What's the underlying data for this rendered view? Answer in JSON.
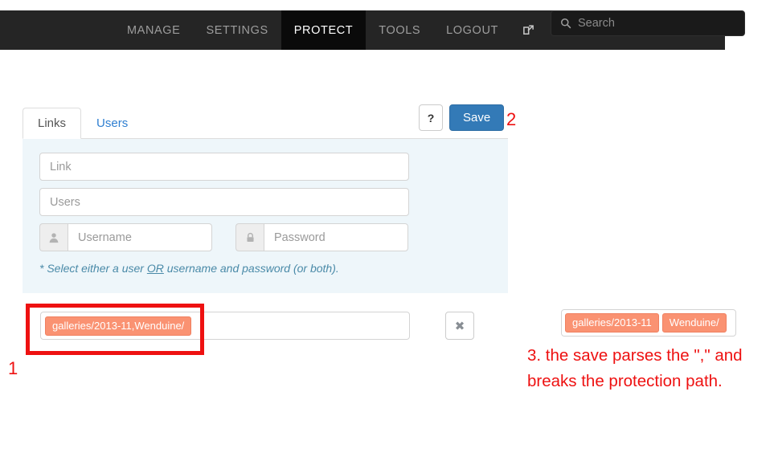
{
  "navbar": {
    "items": [
      {
        "label": "MANAGE",
        "active": false
      },
      {
        "label": "SETTINGS",
        "active": false
      },
      {
        "label": "PROTECT",
        "active": true
      },
      {
        "label": "TOOLS",
        "active": false
      },
      {
        "label": "LOGOUT",
        "active": false
      }
    ],
    "external_link_icon": "external-link-icon",
    "search": {
      "icon": "search-icon",
      "placeholder": "Search",
      "value": ""
    },
    "background_color": "#252525",
    "active_background_color": "#0a0a0a"
  },
  "panel": {
    "tabs": [
      {
        "label": "Links",
        "active": true
      },
      {
        "label": "Users",
        "active": false
      }
    ],
    "actions": {
      "help_label": "?",
      "save_label": "Save",
      "save_color": "#337ab7"
    },
    "form": {
      "link_placeholder": "Link",
      "link_value": "",
      "users_placeholder": "Users",
      "users_value": "",
      "username_placeholder": "Username",
      "username_value": "",
      "username_icon": "user-icon",
      "password_placeholder": "Password",
      "password_value": "",
      "password_icon": "lock-icon",
      "hint_prefix": "* Select either a user ",
      "hint_or": "OR",
      "hint_suffix": " username and password (or both)."
    },
    "background_color": "#eef6fa"
  },
  "tag_row": {
    "tags": [
      {
        "label": "galleries/2013-11,Wenduine/"
      }
    ],
    "tag_color": "#fa9272",
    "remove_button_icon": "close-icon",
    "remove_button_label": "✖"
  },
  "result_row": {
    "tags": [
      {
        "label": "galleries/2013-11"
      },
      {
        "label": "Wenduine/"
      }
    ]
  },
  "annotations": {
    "color": "#ee1111",
    "marker_1": "1",
    "marker_2": "2",
    "note_3": "3. the save parses the \",\" and breaks the protection path."
  }
}
